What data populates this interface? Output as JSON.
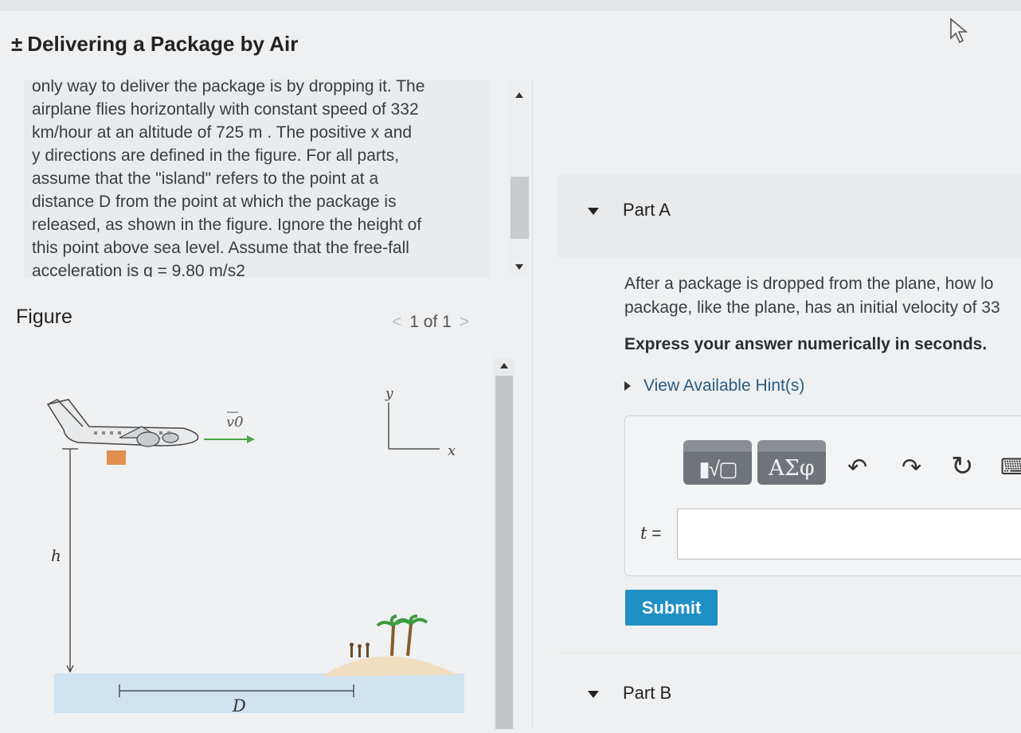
{
  "header": {
    "title_prefix": "±",
    "title": "Delivering a Package by Air"
  },
  "problem": {
    "lines": [
      "only way to deliver the package is by dropping it. The",
      "airplane flies horizontally with constant speed of 332",
      "km/hour at an altitude of 725 m . The positive x and",
      "y directions are defined in the figure. For all parts,",
      "assume that the \"island\" refers to the point at a",
      "distance D from the point at which the package is",
      "released, as shown in the figure. Ignore the height of",
      "this point above sea level. Assume that the free-fall",
      "acceleration is g = 9.80 m/s2"
    ]
  },
  "figure": {
    "label": "Figure",
    "pager": "1 of 1",
    "prev": "<",
    "next": ">",
    "labels": {
      "v0": "v0",
      "y": "y",
      "x": "x",
      "h": "h",
      "D": "D"
    }
  },
  "partA": {
    "title": "Part A",
    "question_line1": "After a package is dropped from the plane, how lo",
    "question_line2": "package, like the plane, has an initial velocity of 33",
    "express": "Express your answer numerically in seconds.",
    "hints": "View Available Hint(s)",
    "toolbar": {
      "templates": "▮√▢",
      "greek": "ΑΣφ",
      "undo": "↶",
      "redo": "↷",
      "reset": "↻",
      "keyboard": "⌨"
    },
    "variable": "t",
    "equals": "=",
    "input_value": "",
    "submit": "Submit"
  },
  "partB": {
    "title": "Part B"
  },
  "colors": {
    "submit": "#1f8fc5",
    "link": "#2a5b80",
    "sea": "#cfe3f1",
    "sand": "#f1dec0",
    "velocity_arrow": "#4aa84a",
    "package": "#e0904c"
  }
}
